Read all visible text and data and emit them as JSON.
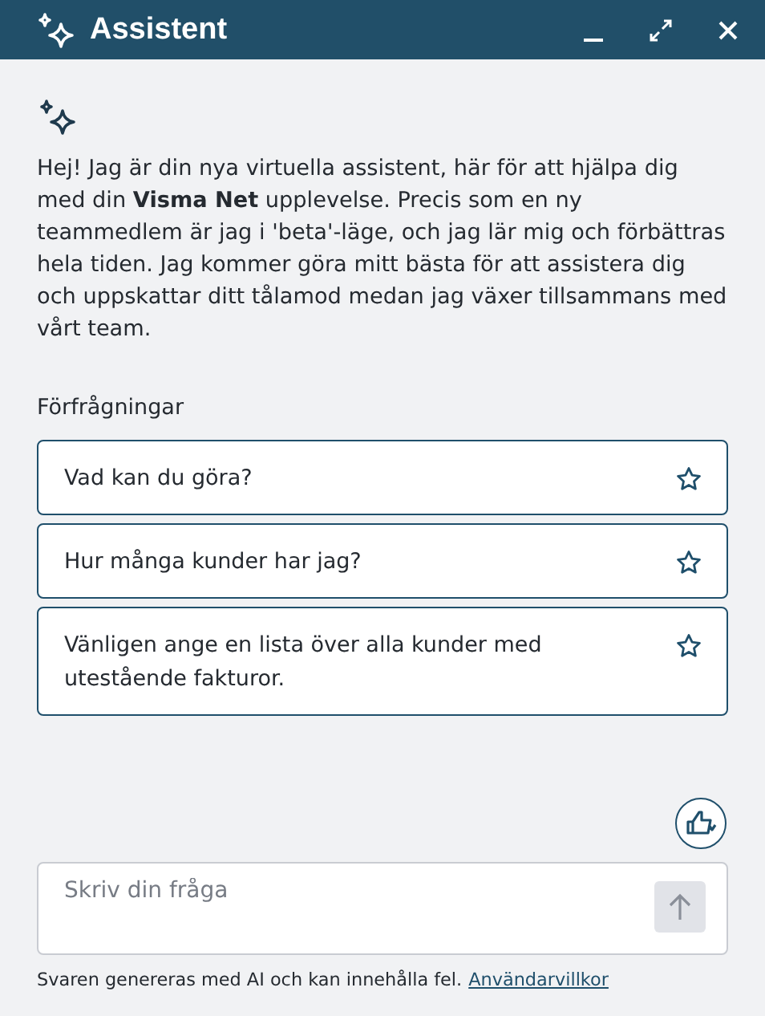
{
  "window": {
    "title": "Assistent"
  },
  "intro": "Hej! Jag är din nya virtuella assistent, här för att hjälpa dig med din **Visma Net** upplevelse. Precis som en ny teammedlem är jag i 'beta'-läge, och jag lär mig och förbättras hela tiden. Jag kommer göra mitt bästa för att assistera dig och uppskattar ditt tålamod medan jag växer tillsammans med vårt team.",
  "requests": {
    "heading": "Förfrågningar",
    "items": [
      {
        "text": "Vad kan du göra?",
        "favorite": false
      },
      {
        "text": "Hur många kunder har jag?",
        "favorite": false
      },
      {
        "text": "Vänligen ange en lista över alla kunder med utestående fakturor.",
        "favorite": false
      }
    ]
  },
  "input": {
    "placeholder": "Skriv din fråga"
  },
  "footer": {
    "text": "Svaren genereras med AI och kan innehålla fel.",
    "link": "Användarvillkor"
  }
}
